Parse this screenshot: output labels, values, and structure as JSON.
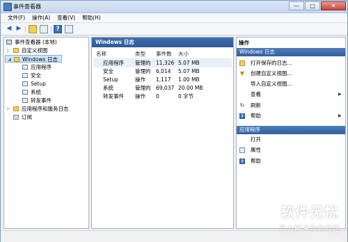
{
  "window": {
    "title": "事件查看器",
    "controls": {
      "min": "—",
      "max": "□",
      "close": "✕"
    }
  },
  "menu": [
    "文件(F)",
    "操作(A)",
    "查看(V)",
    "帮助(H)"
  ],
  "toolbar": {
    "icons": [
      "back-arrow-icon",
      "forward-arrow-icon",
      "up-folder-icon",
      "show-tree-icon",
      "help-icon",
      "properties-icon"
    ]
  },
  "tree": {
    "root": "事件查看器 (本地)",
    "custom_views": "自定义视图",
    "windows_logs": "Windows 日志",
    "children": [
      "应用程序",
      "安全",
      "Setup",
      "系统",
      "转发事件"
    ],
    "app_service_logs": "应用程序和服务日志",
    "subscriptions": "订阅"
  },
  "center": {
    "header": "Windows 日志",
    "columns": [
      "名称",
      "类型",
      "事件数",
      "大小"
    ],
    "rows": [
      {
        "name": "应用程序",
        "type": "管理的",
        "count": "11,326",
        "size": "5.07 MB"
      },
      {
        "name": "安全",
        "type": "管理的",
        "count": "6,014",
        "size": "5.07 MB"
      },
      {
        "name": "Setup",
        "type": "操作",
        "count": "1,117",
        "size": "1.00 MB"
      },
      {
        "name": "系统",
        "type": "管理的",
        "count": "69,037",
        "size": "20.00 MB"
      },
      {
        "name": "转发事件",
        "type": "操作",
        "count": "0",
        "size": "0 字节"
      }
    ]
  },
  "actions": {
    "title": "操作",
    "section1": {
      "header": "Windows 日志",
      "items": [
        "打开保存的日志...",
        "创建自定义视图...",
        "导入自定义视图...",
        "查看",
        "刷新",
        "帮助"
      ]
    },
    "section2": {
      "header": "应用程序",
      "items": [
        "打开",
        "属性",
        "帮助"
      ]
    }
  },
  "watermark": {
    "title": "软件无忧",
    "subtitle": "努力解决你的问题"
  },
  "colors": {
    "accent": "#2e5a96",
    "selection": "#cfe4fa"
  }
}
